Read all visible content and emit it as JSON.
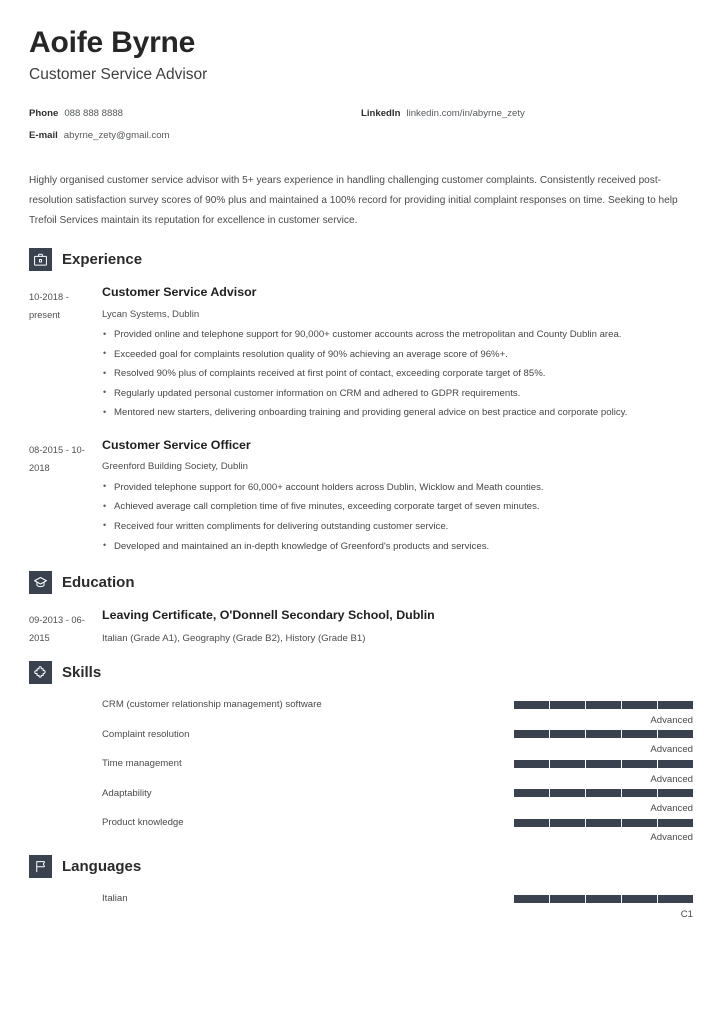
{
  "header": {
    "name": "Aoife Byrne",
    "job_title": "Customer Service Advisor",
    "contacts": [
      {
        "label": "Phone",
        "value": "088 888 8888",
        "name": "phone"
      },
      {
        "label": "LinkedIn",
        "value": "linkedin.com/in/abyrne_zety",
        "name": "linkedin"
      },
      {
        "label": "E-mail",
        "value": "abyrne_zety@gmail.com",
        "name": "email"
      }
    ]
  },
  "summary": "Highly organised customer service advisor with 5+ years experience in handling challenging customer complaints. Consistently received post-resolution satisfaction survey scores of 90% plus and maintained a 100% record for providing initial complaint responses on time. Seeking to help Trefoil Services maintain its reputation for excellence in customer service.",
  "sections": {
    "experience": {
      "title": "Experience",
      "icon": "briefcase-icon",
      "entries": [
        {
          "dates": "10-2018 - present",
          "role": "Customer Service Advisor",
          "org": "Lycan Systems, Dublin",
          "bullets": [
            "Provided online and telephone support for 90,000+ customer accounts across the metropolitan and County Dublin area.",
            "Exceeded goal for complaints resolution quality of 90% achieving an average score of 96%+.",
            "Resolved 90% plus of complaints received at first point of contact, exceeding corporate target of 85%.",
            "Regularly updated personal customer information on CRM and adhered to GDPR requirements.",
            "Mentored new starters, delivering onboarding training and providing general advice on best practice and corporate policy."
          ]
        },
        {
          "dates": "08-2015 - 10-2018",
          "role": "Customer Service Officer",
          "org": "Greenford Building Society, Dublin",
          "bullets": [
            "Provided telephone support for 60,000+ account holders across Dublin, Wicklow and Meath counties.",
            "Achieved average call completion time of five minutes, exceeding corporate target of seven minutes.",
            "Received four written compliments for delivering outstanding customer service.",
            "Developed and maintained an in-depth knowledge of Greenford's products and services."
          ]
        }
      ]
    },
    "education": {
      "title": "Education",
      "icon": "graduation-cap-icon",
      "entries": [
        {
          "dates": "09-2013 - 06-2015",
          "degree": "Leaving Certificate, O'Donnell Secondary School, Dublin",
          "details": "Italian (Grade A1), Geography (Grade B2), History (Grade B1)"
        }
      ]
    },
    "skills": {
      "title": "Skills",
      "icon": "puzzle-icon",
      "items": [
        {
          "name": "CRM (customer relationship management) software",
          "level": "Advanced",
          "filled": 5,
          "total": 5
        },
        {
          "name": "Complaint resolution",
          "level": "Advanced",
          "filled": 5,
          "total": 5
        },
        {
          "name": "Time management",
          "level": "Advanced",
          "filled": 5,
          "total": 5
        },
        {
          "name": "Adaptability",
          "level": "Advanced",
          "filled": 5,
          "total": 5
        },
        {
          "name": "Product knowledge",
          "level": "Advanced",
          "filled": 5,
          "total": 5
        }
      ]
    },
    "languages": {
      "title": "Languages",
      "icon": "flag-icon",
      "items": [
        {
          "name": "Italian",
          "level": "C1",
          "filled": 5,
          "total": 5
        }
      ]
    }
  },
  "colors": {
    "icon_badge": "#3a4250",
    "bar_fill": "#3a4250",
    "heading": "#2b2b2b",
    "body_text": "#474747"
  }
}
